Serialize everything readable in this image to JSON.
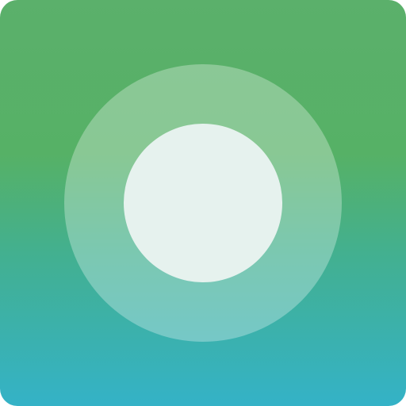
{
  "icon": {
    "name": "record-button-app-icon",
    "colors": {
      "gradient_top": "#5bb06b",
      "gradient_bottom": "#34b2c7",
      "ring": "#ffffff",
      "dot": "#e6f2ee"
    }
  }
}
